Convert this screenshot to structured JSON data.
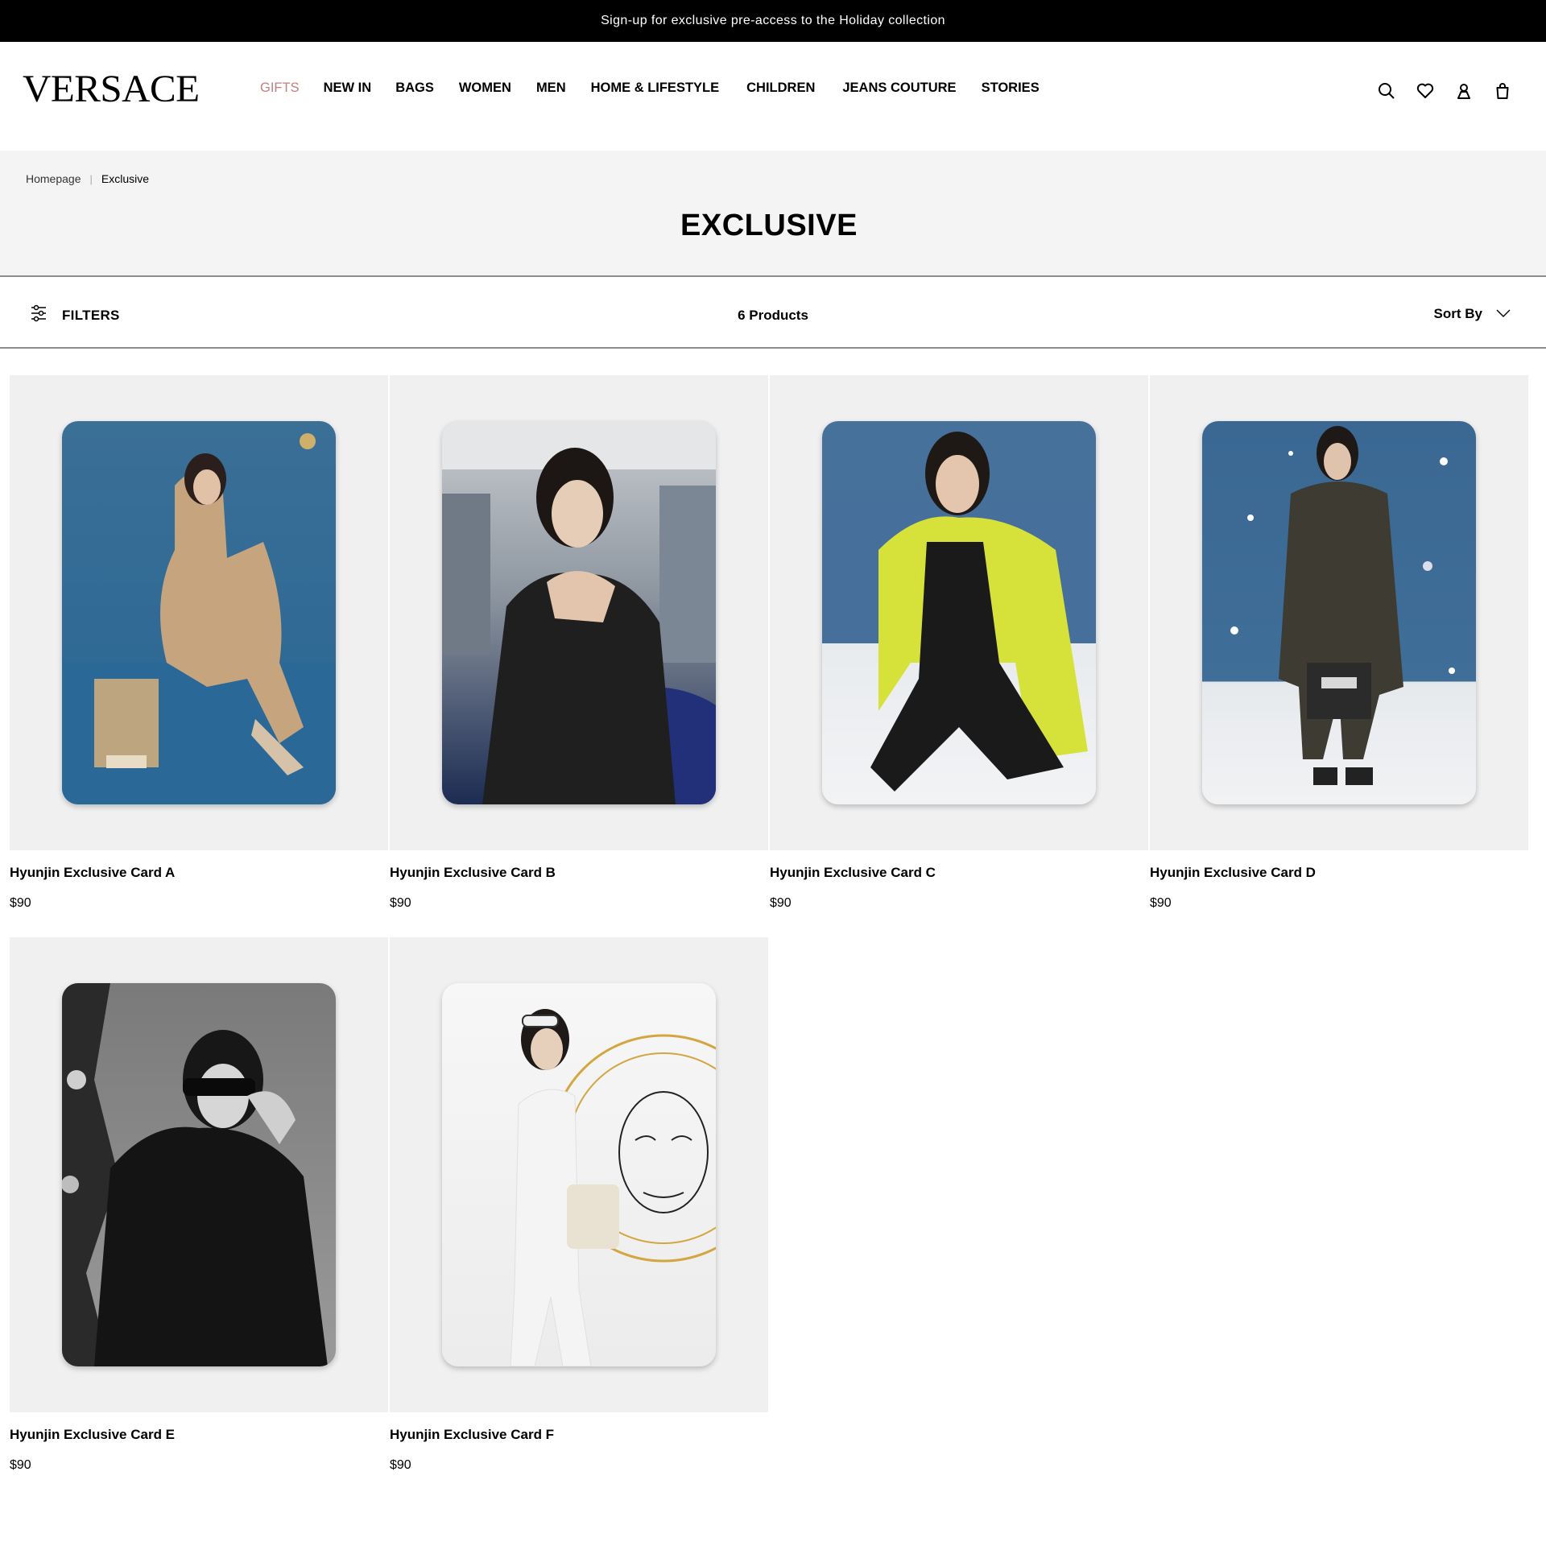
{
  "announcement": "Sign-up for exclusive pre-access to the Holiday collection",
  "brand": "VERSACE",
  "nav": [
    {
      "label": "GIFTS"
    },
    {
      "label": "NEW IN"
    },
    {
      "label": "BAGS"
    },
    {
      "label": "WOMEN"
    },
    {
      "label": "MEN"
    },
    {
      "label": "HOME & LIFESTYLE"
    },
    {
      "label": "CHILDREN"
    },
    {
      "label": "JEANS COUTURE"
    },
    {
      "label": "STORIES"
    }
  ],
  "header_icons": [
    "search-icon",
    "wishlist-heart-icon",
    "account-icon",
    "shopping-bag-icon"
  ],
  "colors": {
    "gifts": "#c08080",
    "announcement_bg": "#000000",
    "hero_bg": "#f4f4f4",
    "card_bg": "#f0f0f0"
  },
  "breadcrumb": {
    "home": "Homepage",
    "separator": "|",
    "current": "Exclusive"
  },
  "page_title": "EXCLUSIVE",
  "toolbar": {
    "filters": "FILTERS",
    "count": "6 Products",
    "sort": "Sort By"
  },
  "products": [
    {
      "name": "Hyunjin Exclusive Card A",
      "price": "$90"
    },
    {
      "name": "Hyunjin Exclusive Card B",
      "price": "$90"
    },
    {
      "name": "Hyunjin Exclusive Card C",
      "price": "$90"
    },
    {
      "name": "Hyunjin Exclusive Card D",
      "price": "$90"
    },
    {
      "name": "Hyunjin Exclusive Card E",
      "price": "$90"
    },
    {
      "name": "Hyunjin Exclusive Card F",
      "price": "$90"
    }
  ]
}
